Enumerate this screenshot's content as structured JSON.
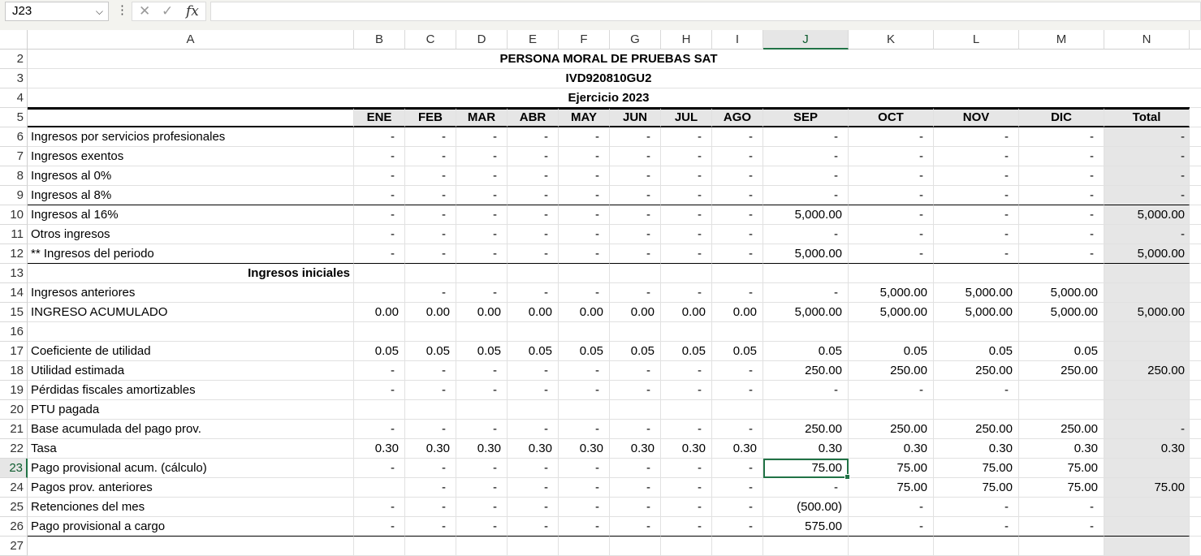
{
  "formula_bar": {
    "name_box": "J23",
    "cancel_icon": "close-icon",
    "enter_icon": "check-icon",
    "fx_label": "fx",
    "formula": ""
  },
  "columns": [
    "A",
    "B",
    "C",
    "D",
    "E",
    "F",
    "G",
    "H",
    "I",
    "J",
    "K",
    "L",
    "M",
    "N"
  ],
  "selected_column": "J",
  "selected_row": 23,
  "accent_color": "#217346",
  "header_fill": "#e6e6e6",
  "sheet": {
    "title1": "PERSONA MORAL DE PRUEBAS SAT",
    "title2": "IVD920810GU2",
    "title3": "Ejercicio 2023",
    "months": [
      "ENE",
      "FEB",
      "MAR",
      "ABR",
      "MAY",
      "JUN",
      "JUL",
      "AGO",
      "SEP",
      "OCT",
      "NOV",
      "DIC",
      "Total"
    ],
    "rows": [
      {
        "n": 6,
        "label": "Ingresos por servicios profesionales",
        "v": [
          "-",
          "-",
          "-",
          "-",
          "-",
          "-",
          "-",
          "-",
          "-",
          "-",
          "-",
          "-",
          "-"
        ]
      },
      {
        "n": 7,
        "label": "Ingresos exentos",
        "v": [
          "-",
          "-",
          "-",
          "-",
          "-",
          "-",
          "-",
          "-",
          "-",
          "-",
          "-",
          "-",
          "-"
        ]
      },
      {
        "n": 8,
        "label": "Ingresos al 0%",
        "v": [
          "-",
          "-",
          "-",
          "-",
          "-",
          "-",
          "-",
          "-",
          "-",
          "-",
          "-",
          "-",
          "-"
        ]
      },
      {
        "n": 9,
        "label": "Ingresos al 8%",
        "v": [
          "-",
          "-",
          "-",
          "-",
          "-",
          "-",
          "-",
          "-",
          "-",
          "-",
          "-",
          "-",
          "-"
        ]
      },
      {
        "n": 10,
        "label": "Ingresos al 16%",
        "v": [
          "-",
          "-",
          "-",
          "-",
          "-",
          "-",
          "-",
          "-",
          "5,000.00",
          "-",
          "-",
          "-",
          "5,000.00"
        ]
      },
      {
        "n": 11,
        "label": "Otros ingresos",
        "v": [
          "-",
          "-",
          "-",
          "-",
          "-",
          "-",
          "-",
          "-",
          "-",
          "-",
          "-",
          "-",
          "-"
        ]
      },
      {
        "n": 12,
        "label": "** Ingresos del periodo",
        "v": [
          "-",
          "-",
          "-",
          "-",
          "-",
          "-",
          "-",
          "-",
          "5,000.00",
          "-",
          "-",
          "-",
          "5,000.00"
        ]
      },
      {
        "n": 13,
        "label": "Ingresos iniciales",
        "v": [
          "",
          "",
          "",
          "",
          "",
          "",
          "",
          "",
          "",
          "",
          "",
          "",
          ""
        ]
      },
      {
        "n": 14,
        "label": "Ingresos anteriores",
        "v": [
          "",
          "-",
          "-",
          "-",
          "-",
          "-",
          "-",
          "-",
          "-",
          "5,000.00",
          "5,000.00",
          "5,000.00",
          ""
        ]
      },
      {
        "n": 15,
        "label": "INGRESO ACUMULADO",
        "v": [
          "0.00",
          "0.00",
          "0.00",
          "0.00",
          "0.00",
          "0.00",
          "0.00",
          "0.00",
          "5,000.00",
          "5,000.00",
          "5,000.00",
          "5,000.00",
          "5,000.00"
        ]
      },
      {
        "n": 16,
        "label": "",
        "v": [
          "",
          "",
          "",
          "",
          "",
          "",
          "",
          "",
          "",
          "",
          "",
          "",
          ""
        ]
      },
      {
        "n": 17,
        "label": "Coeficiente de utilidad",
        "v": [
          "0.05",
          "0.05",
          "0.05",
          "0.05",
          "0.05",
          "0.05",
          "0.05",
          "0.05",
          "0.05",
          "0.05",
          "0.05",
          "0.05",
          ""
        ]
      },
      {
        "n": 18,
        "label": "Utilidad estimada",
        "v": [
          "-",
          "-",
          "-",
          "-",
          "-",
          "-",
          "-",
          "-",
          "250.00",
          "250.00",
          "250.00",
          "250.00",
          "250.00"
        ]
      },
      {
        "n": 19,
        "label": "Pérdidas fiscales amortizables",
        "v": [
          "-",
          "-",
          "-",
          "-",
          "-",
          "-",
          "-",
          "-",
          "-",
          "-",
          "-",
          "",
          ""
        ]
      },
      {
        "n": 20,
        "label": "PTU pagada",
        "v": [
          "",
          "",
          "",
          "",
          "",
          "",
          "",
          "",
          "",
          "",
          "",
          "",
          ""
        ]
      },
      {
        "n": 21,
        "label": "Base acumulada del pago prov.",
        "v": [
          "-",
          "-",
          "-",
          "-",
          "-",
          "-",
          "-",
          "-",
          "250.00",
          "250.00",
          "250.00",
          "250.00",
          "-"
        ]
      },
      {
        "n": 22,
        "label": "Tasa",
        "v": [
          "0.30",
          "0.30",
          "0.30",
          "0.30",
          "0.30",
          "0.30",
          "0.30",
          "0.30",
          "0.30",
          "0.30",
          "0.30",
          "0.30",
          "0.30"
        ]
      },
      {
        "n": 23,
        "label": "Pago provisional acum. (cálculo)",
        "v": [
          "-",
          "-",
          "-",
          "-",
          "-",
          "-",
          "-",
          "-",
          "75.00",
          "75.00",
          "75.00",
          "75.00",
          ""
        ]
      },
      {
        "n": 24,
        "label": "Pagos prov. anteriores",
        "v": [
          "",
          "-",
          "-",
          "-",
          "-",
          "-",
          "-",
          "-",
          "-",
          "75.00",
          "75.00",
          "75.00",
          "75.00"
        ]
      },
      {
        "n": 25,
        "label": "Retenciones del mes",
        "v": [
          "-",
          "-",
          "-",
          "-",
          "-",
          "-",
          "-",
          "-",
          "(500.00)",
          "-",
          "-",
          "-",
          ""
        ]
      },
      {
        "n": 26,
        "label": "Pago provisional a cargo",
        "v": [
          "-",
          "-",
          "-",
          "-",
          "-",
          "-",
          "-",
          "-",
          "575.00",
          "-",
          "-",
          "-",
          ""
        ]
      },
      {
        "n": 27,
        "label": "",
        "v": [
          "",
          "",
          "",
          "",
          "",
          "",
          "",
          "",
          "",
          "",
          "",
          "",
          ""
        ]
      }
    ]
  }
}
